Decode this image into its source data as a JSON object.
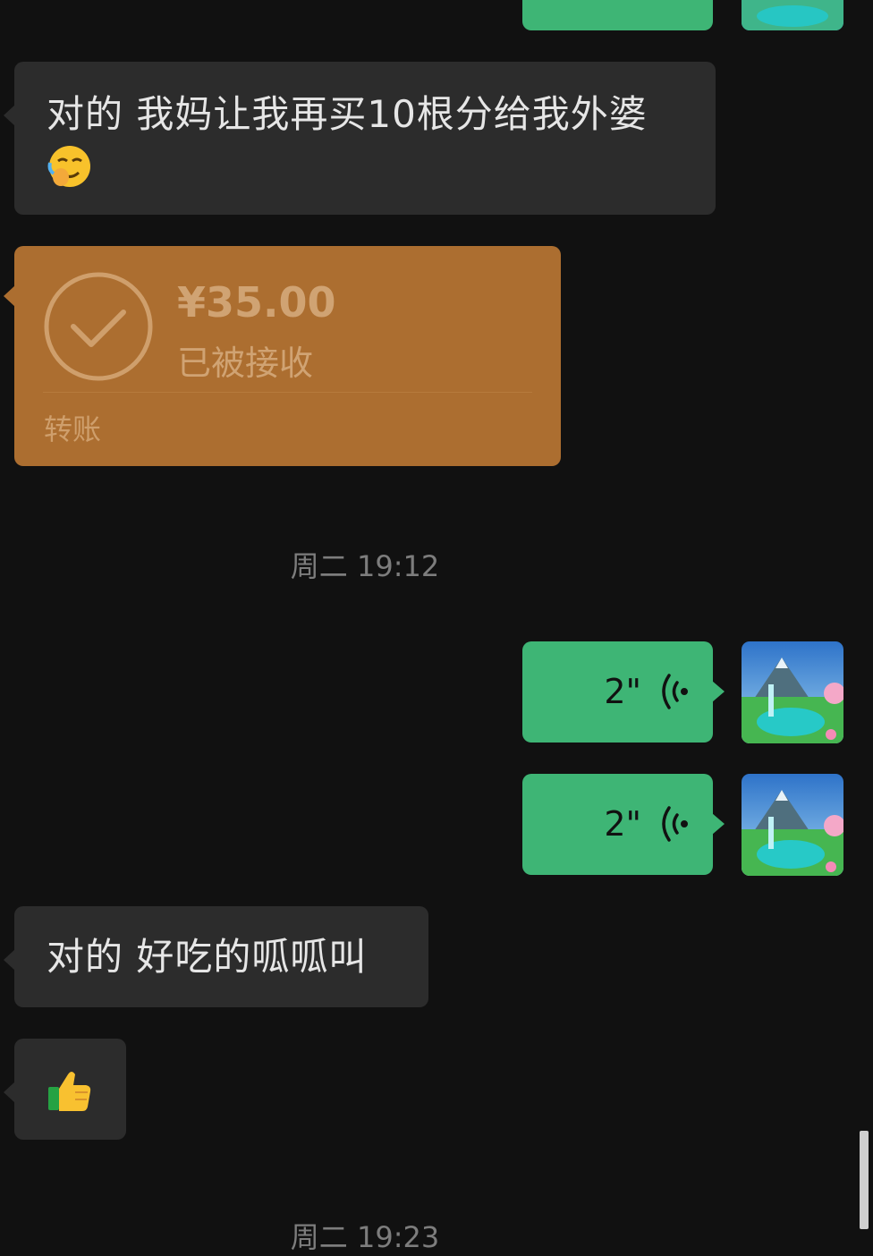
{
  "messages": {
    "m1_text": "对的 我妈让我再买10根分给我外婆",
    "m1_emoji": "face-with-hand-over-mouth-laughing",
    "transfer": {
      "amount": "¥35.00",
      "status": "已被接收",
      "label": "转账"
    },
    "timestamp1": "周二 19:12",
    "voice1_duration": "2\"",
    "voice2_duration": "2\"",
    "m2_text": "对的 好吃的呱呱叫",
    "m3_emoji": "thumbs-up",
    "timestamp2_partial": "周二 19:23"
  },
  "colors": {
    "background": "#111111",
    "received_bubble": "#2c2c2c",
    "sent_bubble": "#3eb575",
    "transfer_card": "#ac6e30"
  }
}
